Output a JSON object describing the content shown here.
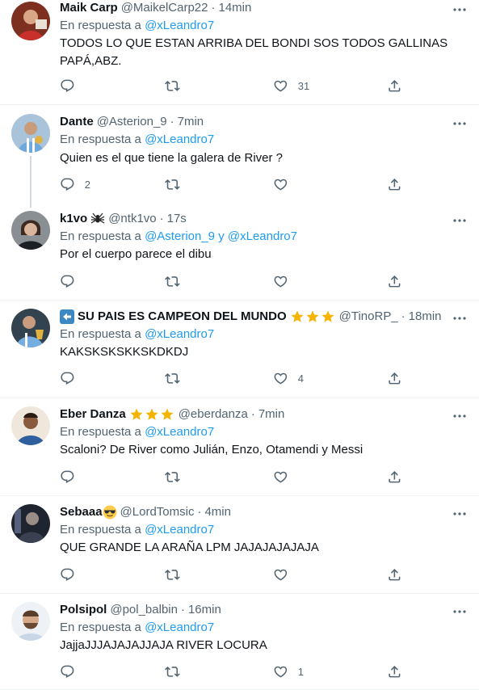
{
  "reply_prefix": "En respuesta a",
  "reply_conj": "y",
  "tweets": [
    {
      "name": "Maik Carp",
      "handle": "@MaikelCarp22",
      "time": "14min",
      "reply_to": [
        "@xLeandro7"
      ],
      "text": "TODOS LO QUE ESTAN ARRIBA DEL BONDI SOS TODOS GALLINAS PAPÁ,ABZ.",
      "replies": "",
      "retweets": "",
      "likes": "31"
    },
    {
      "name": "Dante",
      "handle": "@Asterion_9",
      "time": "7min",
      "reply_to": [
        "@xLeandro7"
      ],
      "text": "Quien es el que tiene la galera de River ?",
      "replies": "2",
      "retweets": "",
      "likes": ""
    },
    {
      "name": "k1vo",
      "name_emoji": "🕷",
      "handle": "@ntk1vo",
      "time": "17s",
      "reply_to": [
        "@Asterion_9",
        "@xLeandro7"
      ],
      "text": "Por el cuerpo parece el dibu",
      "replies": "",
      "retweets": "",
      "likes": ""
    },
    {
      "name_emoji": "⬅",
      "name": "SU PAIS ES CAMPEON DEL MUNDO",
      "stars": 3,
      "handle": "@TinoRP_",
      "time": "18min",
      "reply_to": [
        "@xLeandro7"
      ],
      "text": "KAKSKSKSKKSKDKDJ",
      "replies": "",
      "retweets": "",
      "likes": "4"
    },
    {
      "name": "Eber Danza",
      "stars": 3,
      "handle": "@eberdanza",
      "time": "7min",
      "reply_to": [],
      "text": "Scaloni? De River como Julián, Enzo, Otamendi y Messi",
      "replies": "",
      "retweets": "",
      "likes": ""
    },
    {
      "name": "Sebaaa",
      "name_emoji": "😎",
      "handle": "@LordTomsic",
      "time": "4min",
      "reply_to": [
        "@xLeandro7"
      ],
      "text": "QUE GRANDE LA ARAÑA LPM JAJAJAJAJAJA",
      "replies": "",
      "retweets": "",
      "likes": ""
    },
    {
      "name": "Polsipol",
      "handle": "@pol_balbin",
      "time": "16min",
      "reply_to": [
        "@xLeandro7"
      ],
      "text": "JajjaJJJAJAJAJJAJA RIVER LOCURA",
      "replies": "",
      "retweets": "",
      "likes": "1"
    }
  ],
  "colors": {
    "accent": "#1d9bf0",
    "secondary_text": "#536471",
    "star": "#f4b400"
  }
}
